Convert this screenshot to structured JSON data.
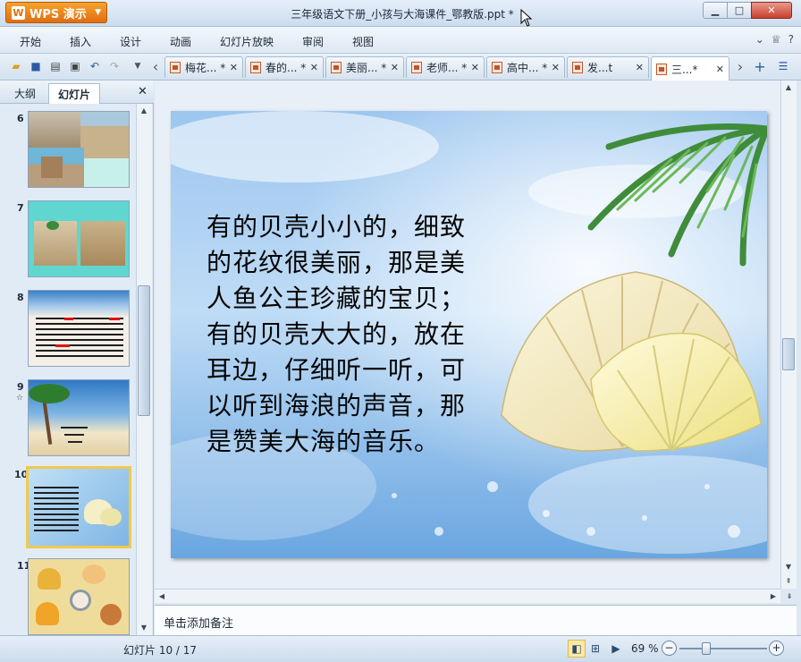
{
  "app": {
    "name": "WPS 演示",
    "logo_letter": "W",
    "document_title": "三年级语文下册_小孩与大海课件_鄂教版.ppt *"
  },
  "menu": {
    "items": [
      "开始",
      "插入",
      "设计",
      "动画",
      "幻灯片放映",
      "审阅",
      "视图"
    ]
  },
  "tabs": [
    {
      "label": "梅花... *",
      "active": false
    },
    {
      "label": "春的... *",
      "active": false
    },
    {
      "label": "美丽... *",
      "active": false
    },
    {
      "label": "老师... *",
      "active": false
    },
    {
      "label": "高中... *",
      "active": false
    },
    {
      "label": "发...t",
      "active": false
    },
    {
      "label": "三...*",
      "active": true
    }
  ],
  "sidebar": {
    "tab_outline": "大纲",
    "tab_slides": "幻灯片",
    "thumbnails": [
      {
        "number": "6"
      },
      {
        "number": "7"
      },
      {
        "number": "8"
      },
      {
        "number": "9"
      },
      {
        "number": "10",
        "selected": true
      },
      {
        "number": "11"
      }
    ]
  },
  "slide": {
    "text": "有的贝壳小小的，细致的花纹很美丽，那是美人鱼公主珍藏的宝贝；有的贝壳大大的，放在耳边，仔细听一听，可以听到海浪的声音，那是赞美大海的音乐。"
  },
  "notes": {
    "placeholder": "单击添加备注"
  },
  "status": {
    "slide_counter": "幻灯片 10 / 17",
    "zoom": "69 %",
    "zoom_value": 69
  }
}
